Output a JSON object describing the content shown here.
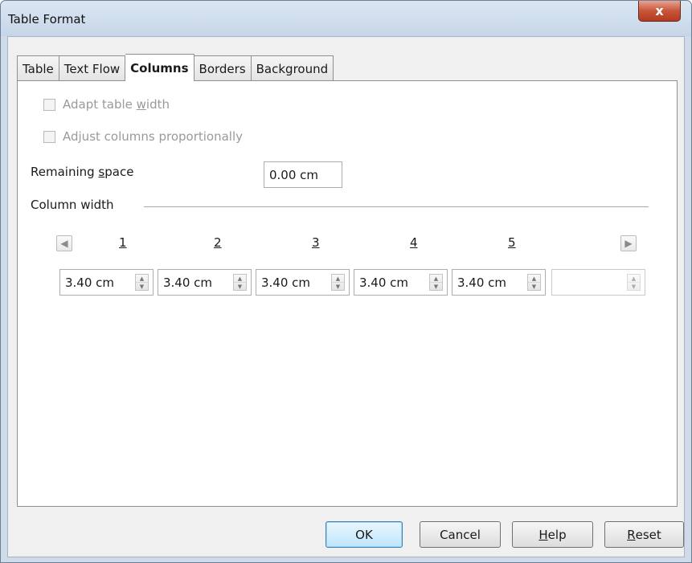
{
  "window": {
    "title": "Table Format",
    "close_glyph": "x"
  },
  "tabs": [
    {
      "label": "Table",
      "active": false
    },
    {
      "label": "Text Flow",
      "active": false
    },
    {
      "label": "Columns",
      "active": true
    },
    {
      "label": "Borders",
      "active": false
    },
    {
      "label": "Background",
      "active": false
    }
  ],
  "options": {
    "adapt_table_width": {
      "pre": "Adapt table ",
      "accel": "w",
      "post": "idth",
      "checked": false,
      "enabled": false
    },
    "adjust_columns": {
      "pre": "Adjust columns proportionally",
      "accel": "",
      "post": "",
      "checked": false,
      "enabled": false
    }
  },
  "remaining_space": {
    "label_pre": "Remaining ",
    "label_accel": "s",
    "label_post": "pace",
    "value": "0.00 cm"
  },
  "column_width": {
    "section_label": "Column width",
    "columns": [
      {
        "number": "1",
        "value": "3.40 cm"
      },
      {
        "number": "2",
        "value": "3.40 cm"
      },
      {
        "number": "3",
        "value": "3.40 cm"
      },
      {
        "number": "4",
        "value": "3.40 cm"
      },
      {
        "number": "5",
        "value": "3.40 cm"
      },
      {
        "number": "",
        "value": ""
      }
    ],
    "prev_icon": "left-arrow-icon",
    "next_icon": "right-arrow-icon"
  },
  "buttons": {
    "ok": "OK",
    "cancel": "Cancel",
    "help_accel": "H",
    "help_rest": "elp",
    "reset_accel": "R",
    "reset_rest": "eset"
  }
}
